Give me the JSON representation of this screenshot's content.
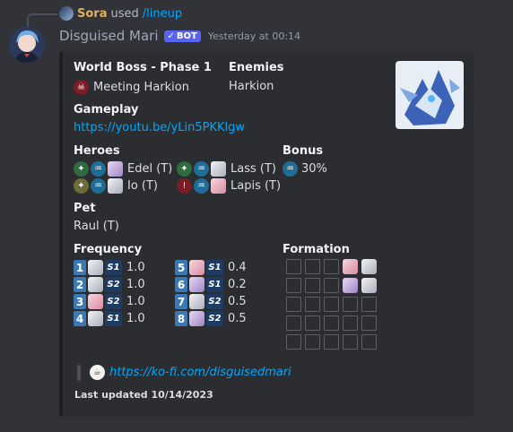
{
  "reply": {
    "username": "Sora",
    "used": "used",
    "command": "/lineup"
  },
  "message": {
    "username": "Disguised Mari",
    "bot_badge": "BOT",
    "timestamp": "Yesterday at 00:14"
  },
  "embed": {
    "boss": {
      "title": "World Boss - Phase 1",
      "value": "Meeting Harkion"
    },
    "enemies": {
      "title": "Enemies",
      "value": "Harkion"
    },
    "gameplay": {
      "title": "Gameplay",
      "link": "https://youtu.be/yLin5PKKlgw"
    },
    "heroes": {
      "title": "Heroes",
      "list": [
        {
          "name": "Edel (T)",
          "class_icon": "green-class-icon",
          "element_icon": "water-element-icon"
        },
        {
          "name": "Lass (T)",
          "class_icon": "green-class-icon",
          "element_icon": "water-element-icon"
        },
        {
          "name": "Io (T)",
          "class_icon": "olive-class-icon",
          "element_icon": "water-element-icon"
        },
        {
          "name": "Lapis (T)",
          "class_icon": "red-class-icon",
          "element_icon": "water-element-icon"
        }
      ]
    },
    "bonus": {
      "title": "Bonus",
      "value": "30%"
    },
    "pet": {
      "title": "Pet",
      "value": "Raul (T)"
    },
    "frequency": {
      "title": "Frequency",
      "left": [
        {
          "n": "1",
          "skill": "S1",
          "value": "1.0"
        },
        {
          "n": "2",
          "skill": "S2",
          "value": "1.0"
        },
        {
          "n": "3",
          "skill": "S2",
          "value": "1.0"
        },
        {
          "n": "4",
          "skill": "S1",
          "value": "1.0"
        }
      ],
      "right": [
        {
          "n": "5",
          "skill": "S1",
          "value": "0.4"
        },
        {
          "n": "6",
          "skill": "S1",
          "value": "0.2"
        },
        {
          "n": "7",
          "skill": "S2",
          "value": "0.5"
        },
        {
          "n": "8",
          "skill": "S2",
          "value": "0.5"
        }
      ]
    },
    "formation": {
      "title": "Formation"
    },
    "kofi": {
      "link": "https://ko-fi.com/disguisedmari"
    },
    "footer": "Last updated 10/14/2023"
  },
  "colors": {
    "link": "#00a8fc",
    "bot_badge": "#5865f2",
    "reply_name": "#e0b15c",
    "skill_number": "#3b79b5"
  }
}
